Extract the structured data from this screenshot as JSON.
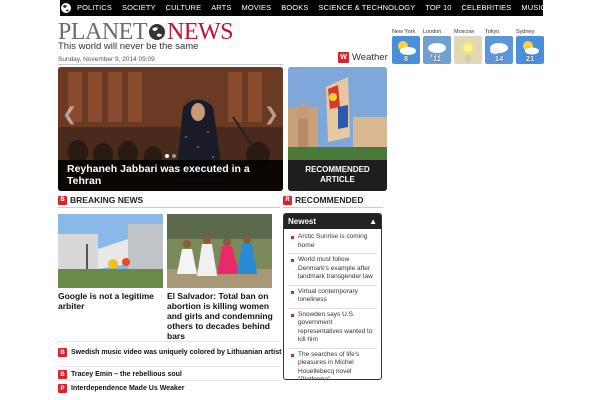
{
  "nav": {
    "items": [
      "Politics",
      "Society",
      "Culture",
      "Arts",
      "Movies",
      "Books",
      "Science & Technology",
      "Top 10",
      "Celebrities",
      "Music"
    ]
  },
  "logo": {
    "part1": "PLANET",
    "part2": "NEWS"
  },
  "tagline": "This world will never be the same",
  "dateline": "Sunday, November 9, 2014 05:09",
  "weather": {
    "badge": "W",
    "title": "Weather",
    "cities": [
      {
        "name": "New York",
        "temp": "8",
        "icon": "sun-cloud-icon",
        "color": "#4a90d9"
      },
      {
        "name": "London",
        "temp": "11",
        "icon": "cloud-icon",
        "color": "#6fa0d0"
      },
      {
        "name": "Moscow",
        "temp": "6",
        "icon": "sun-icon",
        "color": "#e0d8b8"
      },
      {
        "name": "Tokyo",
        "temp": "14",
        "icon": "cloud-icon",
        "color": "#5a96d8"
      },
      {
        "name": "Sydney",
        "temp": "21",
        "icon": "sun-cloud-icon",
        "color": "#4a8fdc"
      }
    ]
  },
  "hero": {
    "caption": "Reyhaneh Jabbari was executed in a Tehran"
  },
  "recommended_card": {
    "caption": "RECOMMENDED ARTICLE"
  },
  "sections": {
    "breaking": {
      "badge": "B",
      "label": "BREAKING NEWS"
    },
    "recommended": {
      "badge": "R",
      "label": "RECOMMENDED"
    }
  },
  "stories": [
    {
      "title": "Google is not a legitime arbiter"
    },
    {
      "title": "El Salvador: Total ban on abortion is killing women and girls and condemning others to decades behind bars"
    }
  ],
  "headlines": [
    {
      "badge": "B",
      "text": "Swedish music video was uniquely colored by Lithuanian artist Vilija Vitkute"
    },
    {
      "badge": "B",
      "text": "Tracey Emin – the rebellious soul"
    },
    {
      "badge": "P",
      "text": "Interdependence Made Us Weaker"
    }
  ],
  "newest": {
    "title": "Newest",
    "items": [
      "Arctic Sunrise is coming home",
      "World must follow Denmark's example after landmark transgender law",
      "Virtual contemporary loneliness",
      "Snowden says U.S. government representatives wanted to kill him",
      "The searches of life's pleasures in Michel Houellebecq novel \"Platforma\""
    ]
  }
}
